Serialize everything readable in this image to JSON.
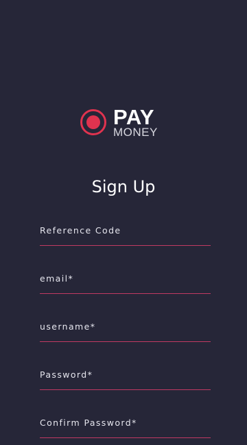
{
  "logo": {
    "word_primary": "PAY",
    "word_secondary": "MONEY",
    "icon": "record-circle-icon",
    "accent_color": "#e0334f"
  },
  "title": "Sign Up",
  "fields": [
    {
      "label": "Reference Code"
    },
    {
      "label": "email*"
    },
    {
      "label": "username*"
    },
    {
      "label": "Password*"
    },
    {
      "label": "Confirm Password*"
    }
  ],
  "colors": {
    "background": "#262638",
    "underline": "#c23a63",
    "text": "#ffffff"
  }
}
